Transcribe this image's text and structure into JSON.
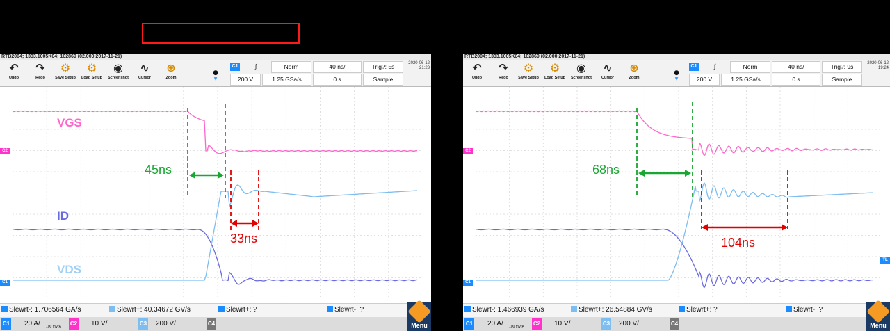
{
  "colors": {
    "vgs": "#ff66cc",
    "id": "#6a6ae0",
    "vds": "#7dbdf0",
    "green": "#1aa632",
    "red": "#e00000",
    "accent": "#1a8cff"
  },
  "toolbar": [
    {
      "icon": "undo-icon",
      "glyph": "↶",
      "label": "Undo"
    },
    {
      "icon": "redo-icon",
      "glyph": "↷",
      "label": "Redo"
    },
    {
      "icon": "save-setup-icon",
      "glyph": "⚙",
      "label": "Save Setup"
    },
    {
      "icon": "load-setup-icon",
      "glyph": "⚙",
      "label": "Load Setup"
    },
    {
      "icon": "camera-icon",
      "glyph": "◉",
      "label": "Screenshot"
    },
    {
      "icon": "cursor-icon",
      "glyph": "∿",
      "label": "Cursor"
    },
    {
      "icon": "zoom-icon",
      "glyph": "⊕",
      "label": "Zoom"
    }
  ],
  "scopes": [
    {
      "title": "RTB2004; 1333.1005K04; 102869 (02.000 2017-11-21)",
      "date": "2020-06-12",
      "time": "21:23",
      "trig_slope": "∫",
      "trig_mode": "Norm",
      "timebase": "40 ns/",
      "trig_status": "Trig?: 5s",
      "trig_level": "200 V",
      "sample_rate": "1.25 GSa/s",
      "offset": "0 s",
      "acq_mode": "Sample",
      "labels": {
        "vgs": "VGS",
        "id": "ID",
        "vds": "VDS"
      },
      "delay_label": "45ns",
      "ring_label": "33ns",
      "slew1": "Slewrt-: 1.706564 GA/s",
      "slew2": "Slewrt+: 40.34672 GV/s",
      "slew3": "Slewrt+: ?",
      "slew4": "Slewrt-: ?",
      "ch1": "20 A/",
      "ch1sub": "100 mV/A",
      "ch2": "10 V/",
      "ch3": "200 V/",
      "ch4": "C4",
      "menu": "Menu"
    },
    {
      "title": "RTB2004; 1333.1005K04; 102869 (02.000 2017-11-21)",
      "date": "2020-06-12",
      "time": "19:24",
      "trig_slope": "∫",
      "trig_mode": "Norm",
      "timebase": "40 ns/",
      "trig_status": "Trig?: 9s",
      "trig_level": "200 V",
      "sample_rate": "1.25 GSa/s",
      "offset": "0 s",
      "acq_mode": "Sample",
      "delay_label": "68ns",
      "ring_label": "104ns",
      "slew1": "Slewrt-: 1.466939 GA/s",
      "slew2": "Slewrt+: 26.54884 GV/s",
      "slew3": "Slewrt+: ?",
      "slew4": "Slewrt-: ?",
      "ch1": "20 A/",
      "ch1sub": "100 mV/A",
      "ch2": "10 V/",
      "ch3": "200 V/",
      "ch4": "C4",
      "menu": "Menu"
    }
  ]
}
